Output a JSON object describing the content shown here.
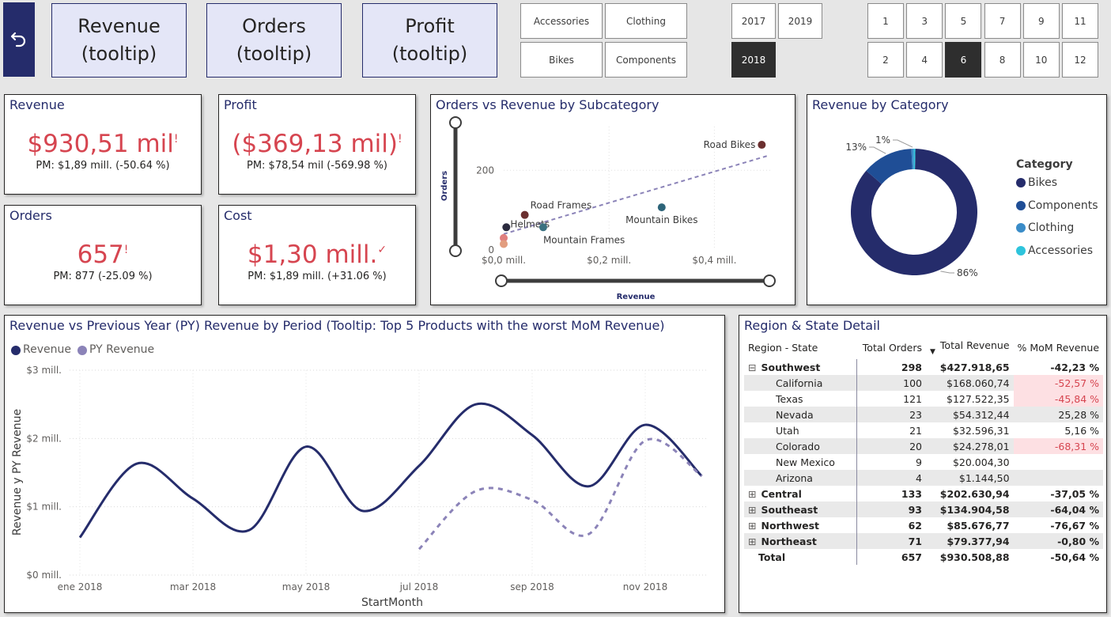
{
  "nav": {
    "back_icon": "undo-arrow-icon",
    "buttons": [
      "Revenue\n(tooltip)",
      "Orders\n(tooltip)",
      "Profit\n(tooltip)"
    ]
  },
  "slicers": {
    "categories": [
      "Accessories",
      "Clothing",
      "Bikes",
      "Components"
    ],
    "years": [
      "2017",
      "2019",
      "2018"
    ],
    "selected_year": "2018",
    "months": [
      "1",
      "3",
      "5",
      "7",
      "9",
      "11",
      "2",
      "4",
      "6",
      "8",
      "10",
      "12"
    ],
    "selected_month": "6"
  },
  "kpis": {
    "revenue": {
      "title": "Revenue",
      "value": "$930,51 mil",
      "mark": "!",
      "pm": "PM: $1,89 mill. (-50.64 %)"
    },
    "profit": {
      "title": "Profit",
      "value": "($369,13 mil)",
      "mark": "!",
      "pm": "PM: $78,54 mil (-569.98 %)"
    },
    "orders": {
      "title": "Orders",
      "value": "657",
      "mark": "!",
      "pm": "PM: 877 (-25.09 %)"
    },
    "cost": {
      "title": "Cost",
      "value": "$1,30 mill.",
      "mark": "✓",
      "pm": "PM: $1,89 mill. (+31.06 %)"
    }
  },
  "colors": {
    "accent": "#252c6b",
    "negative": "#d64550",
    "py": "#8b83b8",
    "highlight_neg": "#fde0e3"
  },
  "scatter": {
    "title": "Orders vs Revenue by Subcategory",
    "xlabel": "Revenue",
    "ylabel": "Orders",
    "x_ticks": [
      "$0,0 mill.",
      "$0,2 mill.",
      "$0,4 mill."
    ],
    "y_ticks": [
      "0",
      "200"
    ],
    "chart_data": {
      "type": "scatter",
      "xlim": [
        0,
        0.5
      ],
      "ylim": [
        0,
        280
      ],
      "points": [
        {
          "label": "Road Bikes",
          "x": 0.49,
          "y": 264,
          "color": "#6b2f2f"
        },
        {
          "label": "Mountain Bikes",
          "x": 0.3,
          "y": 107,
          "color": "#2d6479"
        },
        {
          "label": "Road Frames",
          "x": 0.04,
          "y": 88,
          "color": "#6b2f2f"
        },
        {
          "label": "Helmets",
          "x": 0.005,
          "y": 57,
          "color": "#2b2b3f"
        },
        {
          "label": "Mountain Frames",
          "x": 0.075,
          "y": 57,
          "color": "#3a7080"
        },
        {
          "label": "",
          "x": 0.0,
          "y": 30,
          "color": "#e07f7f"
        },
        {
          "label": "",
          "x": 0.0,
          "y": 15,
          "color": "#e29d7f"
        }
      ],
      "trend": [
        [
          0.0,
          40
        ],
        [
          0.5,
          236
        ]
      ]
    }
  },
  "donut": {
    "title": "Revenue by Category",
    "legend_title": "Category",
    "chart_data": {
      "type": "pie",
      "categories": [
        "Bikes",
        "Components",
        "Clothing",
        "Accessories"
      ],
      "values": [
        86,
        13,
        0.6,
        0.4
      ],
      "colors": [
        "#252c6b",
        "#1f4e96",
        "#3a8cc8",
        "#2ec4dc"
      ],
      "labels": [
        "86%",
        "13%",
        "1%"
      ]
    }
  },
  "line": {
    "title": "Revenue vs Previous Year (PY) Revenue by Period (Tooltip: Top 5 Products with the worst MoM Revenue)",
    "legend": [
      "Revenue",
      "PY Revenue"
    ],
    "xlabel": "StartMonth",
    "ylabel": "Revenue y PY Revenue",
    "x_ticks": [
      "ene 2018",
      "mar 2018",
      "may 2018",
      "jul 2018",
      "sep 2018",
      "nov 2018"
    ],
    "y_ticks": [
      "$0 mill.",
      "$1 mill.",
      "$2 mill.",
      "$3 mill."
    ],
    "chart_data": {
      "type": "line",
      "x": [
        1,
        2,
        3,
        4,
        5,
        6,
        7,
        8,
        9,
        10,
        11,
        12
      ],
      "ylim": [
        0,
        3
      ],
      "series": [
        {
          "name": "Revenue",
          "values": [
            0.55,
            1.63,
            1.12,
            0.66,
            1.88,
            0.94,
            1.6,
            2.5,
            2.05,
            1.3,
            2.2,
            1.45
          ]
        },
        {
          "name": "PY Revenue",
          "values": [
            null,
            null,
            null,
            null,
            null,
            null,
            0.38,
            1.23,
            1.1,
            0.6,
            1.97,
            1.45
          ]
        }
      ]
    }
  },
  "matrix": {
    "title": "Region & State Detail",
    "headers": [
      "Region - State",
      "Total Orders",
      "Total Revenue",
      "% MoM Revenue"
    ],
    "rows": [
      {
        "name": "Southwest",
        "orders": "298",
        "revenue": "$427.918,65",
        "mom": "-42,23 %",
        "level": 0,
        "toggle": "⊟",
        "neg": false,
        "shade": false
      },
      {
        "name": "California",
        "orders": "100",
        "revenue": "$168.060,74",
        "mom": "-52,57 %",
        "level": 1,
        "toggle": "",
        "neg": true,
        "shade": true
      },
      {
        "name": "Texas",
        "orders": "121",
        "revenue": "$127.522,35",
        "mom": "-45,84 %",
        "level": 1,
        "toggle": "",
        "neg": true,
        "shade": false
      },
      {
        "name": "Nevada",
        "orders": "23",
        "revenue": "$54.312,44",
        "mom": "25,28 %",
        "level": 1,
        "toggle": "",
        "neg": false,
        "shade": true
      },
      {
        "name": "Utah",
        "orders": "21",
        "revenue": "$32.596,31",
        "mom": "5,16 %",
        "level": 1,
        "toggle": "",
        "neg": false,
        "shade": false
      },
      {
        "name": "Colorado",
        "orders": "20",
        "revenue": "$24.278,01",
        "mom": "-68,31 %",
        "level": 1,
        "toggle": "",
        "neg": true,
        "shade": true
      },
      {
        "name": "New Mexico",
        "orders": "9",
        "revenue": "$20.004,30",
        "mom": "",
        "level": 1,
        "toggle": "",
        "neg": false,
        "shade": false
      },
      {
        "name": "Arizona",
        "orders": "4",
        "revenue": "$1.144,50",
        "mom": "",
        "level": 1,
        "toggle": "",
        "neg": false,
        "shade": true
      },
      {
        "name": "Central",
        "orders": "133",
        "revenue": "$202.630,94",
        "mom": "-37,05 %",
        "level": 0,
        "toggle": "⊞",
        "neg": false,
        "shade": false
      },
      {
        "name": "Southeast",
        "orders": "93",
        "revenue": "$134.904,58",
        "mom": "-64,04 %",
        "level": 0,
        "toggle": "⊞",
        "neg": false,
        "shade": true
      },
      {
        "name": "Northwest",
        "orders": "62",
        "revenue": "$85.676,77",
        "mom": "-76,67 %",
        "level": 0,
        "toggle": "⊞",
        "neg": false,
        "shade": false
      },
      {
        "name": "Northeast",
        "orders": "71",
        "revenue": "$79.377,94",
        "mom": "-0,80 %",
        "level": 0,
        "toggle": "⊞",
        "neg": false,
        "shade": true
      }
    ],
    "total": {
      "name": "Total",
      "orders": "657",
      "revenue": "$930.508,88",
      "mom": "-50,64 %"
    }
  }
}
